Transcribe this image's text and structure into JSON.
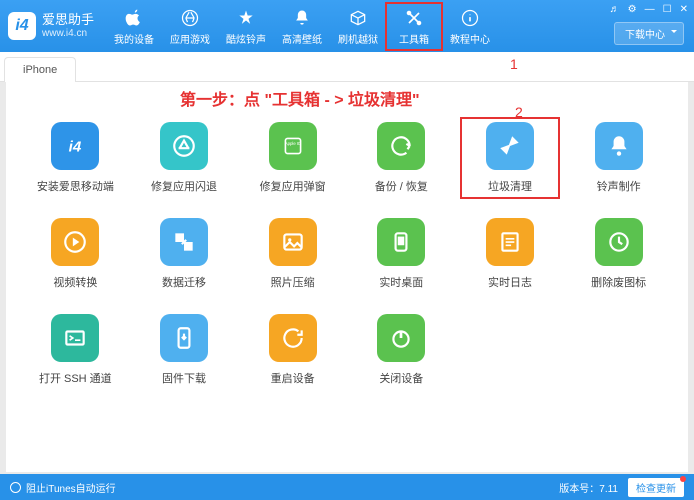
{
  "app": {
    "name": "爱思助手",
    "url": "www.i4.cn",
    "logo_char": "i4"
  },
  "nav": [
    {
      "label": "我的设备",
      "icon": "apple"
    },
    {
      "label": "应用游戏",
      "icon": "apps"
    },
    {
      "label": "酷炫铃声",
      "icon": "music"
    },
    {
      "label": "高清壁纸",
      "icon": "bell"
    },
    {
      "label": "刷机越狱",
      "icon": "box"
    },
    {
      "label": "工具箱",
      "icon": "tools",
      "highlight": true
    },
    {
      "label": "教程中心",
      "icon": "info"
    }
  ],
  "download_center": "下载中心",
  "tab": "iPhone",
  "instruction": "第一步：点 \"工具箱 - > 垃圾清理\"",
  "step_marks": {
    "one": "1",
    "two": "2"
  },
  "tools": [
    [
      {
        "label": "安装爱思移动端",
        "color": "c-blue",
        "icon": "i4"
      },
      {
        "label": "修复应用闪退",
        "color": "c-cyan",
        "icon": "appstore"
      },
      {
        "label": "修复应用弹窗",
        "color": "c-green",
        "icon": "appleid"
      },
      {
        "label": "备份 / 恢复",
        "color": "c-green",
        "icon": "sync"
      },
      {
        "label": "垃圾清理",
        "color": "c-lblue",
        "icon": "broom",
        "highlight": true
      },
      {
        "label": "铃声制作",
        "color": "c-lblue",
        "icon": "bell2"
      }
    ],
    [
      {
        "label": "视频转换",
        "color": "c-orange",
        "icon": "play"
      },
      {
        "label": "数据迁移",
        "color": "c-lblue",
        "icon": "migrate"
      },
      {
        "label": "照片压缩",
        "color": "c-orange",
        "icon": "photo"
      },
      {
        "label": "实时桌面",
        "color": "c-green",
        "icon": "screen"
      },
      {
        "label": "实时日志",
        "color": "c-orange",
        "icon": "log"
      },
      {
        "label": "删除废图标",
        "color": "c-green",
        "icon": "delicon"
      }
    ],
    [
      {
        "label": "打开 SSH 通道",
        "color": "c-teal",
        "icon": "ssh"
      },
      {
        "label": "固件下载",
        "color": "c-lblue",
        "icon": "firmware"
      },
      {
        "label": "重启设备",
        "color": "c-orange",
        "icon": "restart"
      },
      {
        "label": "关闭设备",
        "color": "c-green",
        "icon": "poweroff"
      }
    ]
  ],
  "footer": {
    "itunes": "阻止iTunes自动运行",
    "version_label": "版本号：",
    "version": "7.11",
    "check_update": "检查更新"
  }
}
